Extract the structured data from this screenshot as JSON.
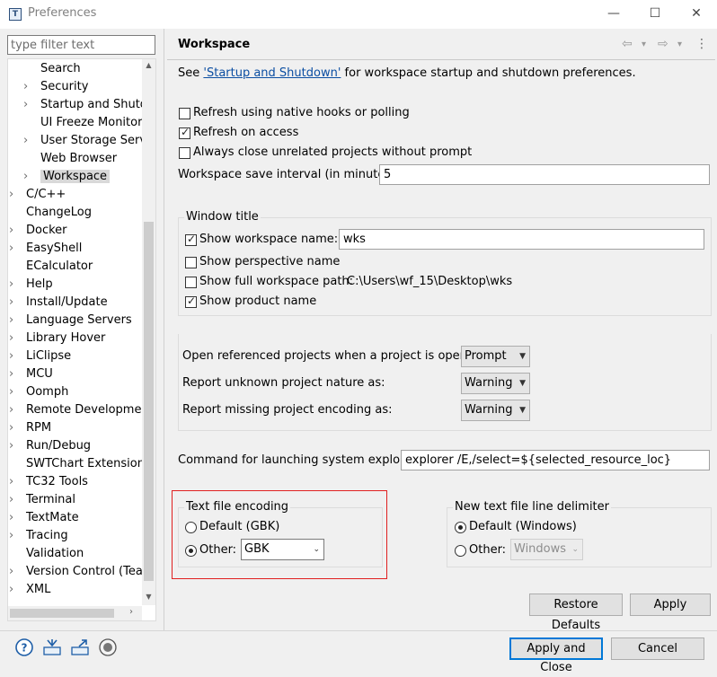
{
  "window": {
    "title": "Preferences",
    "app_icon": "T",
    "minimize": "—",
    "maximize": "☐",
    "close": "✕"
  },
  "filter": {
    "placeholder": "type filter text"
  },
  "tree": [
    {
      "label": "Search",
      "level": 1,
      "arrow": false,
      "selected": false
    },
    {
      "label": "Security",
      "level": 1,
      "arrow": true,
      "selected": false
    },
    {
      "label": "Startup and Shutdo",
      "level": 1,
      "arrow": true,
      "selected": false
    },
    {
      "label": "UI Freeze Monitorin",
      "level": 1,
      "arrow": false,
      "selected": false
    },
    {
      "label": "User Storage Servic",
      "level": 1,
      "arrow": true,
      "selected": false
    },
    {
      "label": "Web Browser",
      "level": 1,
      "arrow": false,
      "selected": false
    },
    {
      "label": "Workspace",
      "level": 1,
      "arrow": true,
      "selected": true
    },
    {
      "label": "C/C++",
      "level": 0,
      "arrow": true,
      "selected": false
    },
    {
      "label": "ChangeLog",
      "level": 0,
      "arrow": false,
      "selected": false
    },
    {
      "label": "Docker",
      "level": 0,
      "arrow": true,
      "selected": false
    },
    {
      "label": "EasyShell",
      "level": 0,
      "arrow": true,
      "selected": false
    },
    {
      "label": "ECalculator",
      "level": 0,
      "arrow": false,
      "selected": false
    },
    {
      "label": "Help",
      "level": 0,
      "arrow": true,
      "selected": false
    },
    {
      "label": "Install/Update",
      "level": 0,
      "arrow": true,
      "selected": false
    },
    {
      "label": "Language Servers",
      "level": 0,
      "arrow": true,
      "selected": false
    },
    {
      "label": "Library Hover",
      "level": 0,
      "arrow": true,
      "selected": false
    },
    {
      "label": "LiClipse",
      "level": 0,
      "arrow": true,
      "selected": false
    },
    {
      "label": "MCU",
      "level": 0,
      "arrow": true,
      "selected": false
    },
    {
      "label": "Oomph",
      "level": 0,
      "arrow": true,
      "selected": false
    },
    {
      "label": "Remote Development",
      "level": 0,
      "arrow": true,
      "selected": false
    },
    {
      "label": "RPM",
      "level": 0,
      "arrow": true,
      "selected": false
    },
    {
      "label": "Run/Debug",
      "level": 0,
      "arrow": true,
      "selected": false
    },
    {
      "label": "SWTChart Extensions",
      "level": 0,
      "arrow": false,
      "selected": false
    },
    {
      "label": "TC32 Tools",
      "level": 0,
      "arrow": true,
      "selected": false
    },
    {
      "label": "Terminal",
      "level": 0,
      "arrow": true,
      "selected": false
    },
    {
      "label": "TextMate",
      "level": 0,
      "arrow": true,
      "selected": false
    },
    {
      "label": "Tracing",
      "level": 0,
      "arrow": true,
      "selected": false
    },
    {
      "label": "Validation",
      "level": 0,
      "arrow": false,
      "selected": false
    },
    {
      "label": "Version Control (Team)",
      "level": 0,
      "arrow": true,
      "selected": false
    },
    {
      "label": "XML",
      "level": 0,
      "arrow": true,
      "selected": false
    }
  ],
  "header": {
    "title": "Workspace",
    "back": "⇦",
    "forward": "⇨",
    "dropdown": "▾",
    "menu": "⋮"
  },
  "intro": {
    "prefix": "See ",
    "link": "'Startup and Shutdown'",
    "suffix": " for workspace startup and shutdown preferences."
  },
  "options": {
    "refresh_native": {
      "label": "Refresh using native hooks or polling",
      "checked": false
    },
    "refresh_access": {
      "label": "Refresh on access",
      "checked": true
    },
    "close_unrelated": {
      "label": "Always close unrelated projects without prompt",
      "checked": false
    },
    "save_interval": {
      "label": "Workspace save interval (in minutes):",
      "value": "5"
    }
  },
  "window_title": {
    "group_label": "Window title",
    "show_name": {
      "label": "Show workspace name:",
      "checked": true,
      "value": "wks"
    },
    "show_perspective": {
      "label": "Show perspective name",
      "checked": false
    },
    "show_path": {
      "label": "Show full workspace path:",
      "checked": false,
      "value": "C:\\Users\\wf_15\\Desktop\\wks"
    },
    "show_product": {
      "label": "Show product name",
      "checked": true
    }
  },
  "projects": {
    "open_referenced": {
      "label": "Open referenced projects when a project is opened:",
      "value": "Prompt"
    },
    "unknown_nature": {
      "label": "Report unknown project nature as:",
      "value": "Warning"
    },
    "missing_encoding": {
      "label": "Report missing project encoding as:",
      "value": "Warning"
    }
  },
  "explorer": {
    "label": "Command for launching system explorer:",
    "value": "explorer /E,/select=${selected_resource_loc}"
  },
  "encoding": {
    "group_label": "Text file encoding",
    "default_label": "Default (GBK)",
    "other_label": "Other:",
    "other_value": "GBK",
    "selected": "other"
  },
  "delimiter": {
    "group_label": "New text file line delimiter",
    "default_label": "Default (Windows)",
    "other_label": "Other:",
    "other_value": "Windows",
    "selected": "default"
  },
  "buttons": {
    "restore": "Restore Defaults",
    "apply": "Apply",
    "apply_close": "Apply and Close",
    "cancel": "Cancel"
  },
  "colors": {
    "accent": "#0078d7",
    "link": "#0b4ea2",
    "highlight": "#e02020"
  }
}
